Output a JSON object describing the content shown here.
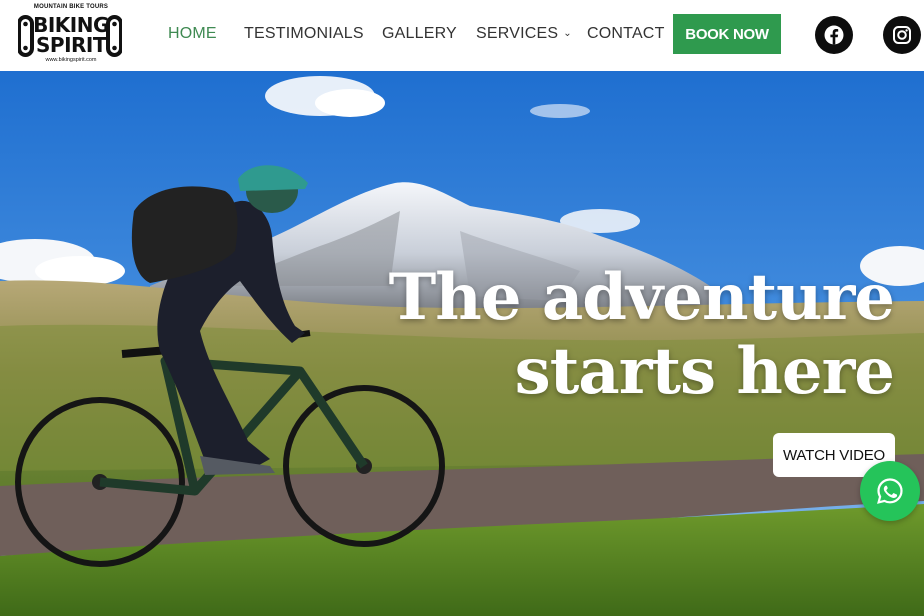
{
  "logo": {
    "tagline": "MOUNTAIN BIKE TOURS",
    "word1": "BIKING",
    "word2": "SPIRIT",
    "url": "www.bikingspirit.com"
  },
  "nav": {
    "home": "HOME",
    "testimonials": "TESTIMONIALS",
    "gallery": "GALLERY",
    "services": "SERVICES",
    "contact": "CONTACT",
    "book": "BOOK NOW",
    "active": "HOME"
  },
  "icons": {
    "services_dropdown": "chevron-down-icon",
    "facebook": "facebook-icon",
    "instagram": "instagram-icon",
    "whatsapp": "whatsapp-icon"
  },
  "hero": {
    "headline_line1": "The adventure",
    "headline_line2": "starts here",
    "watch_video": "WATCH VIDEO"
  },
  "colors": {
    "accent_green": "#2f9a4e",
    "active_nav": "#3f8a52",
    "whatsapp_green": "#25c45a",
    "social_bg": "#0d0d0d"
  }
}
